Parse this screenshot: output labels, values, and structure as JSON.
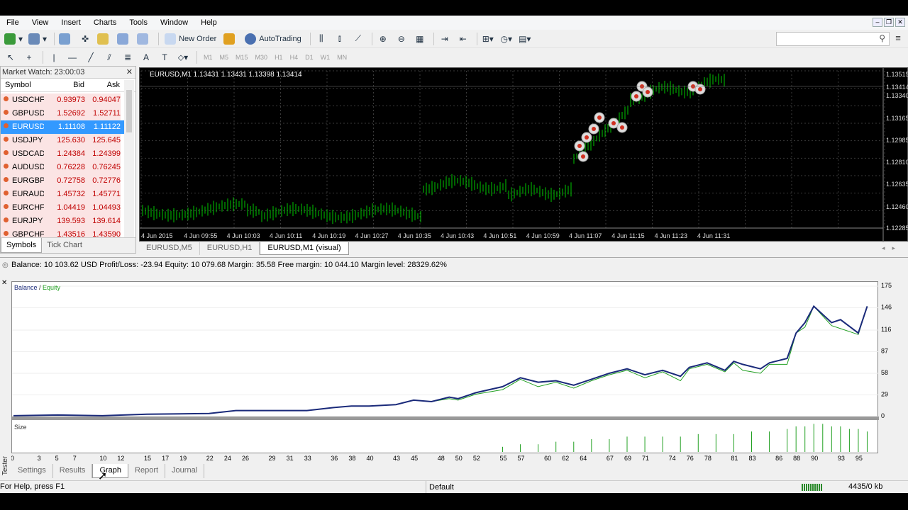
{
  "menu": [
    "File",
    "View",
    "Insert",
    "Charts",
    "Tools",
    "Window",
    "Help"
  ],
  "toolbar": {
    "new_order": "New Order",
    "auto_trading": "AutoTrading",
    "timeframes": [
      "M1",
      "M5",
      "M15",
      "M30",
      "H1",
      "H4",
      "D1",
      "W1",
      "MN"
    ]
  },
  "market_watch": {
    "title": "Market Watch: 23:00:03",
    "headers": {
      "symbol": "Symbol",
      "bid": "Bid",
      "ask": "Ask"
    },
    "rows": [
      {
        "symbol": "USDCHF",
        "bid": "0.93973",
        "ask": "0.94047"
      },
      {
        "symbol": "GBPUSD",
        "bid": "1.52692",
        "ask": "1.52711"
      },
      {
        "symbol": "EURUSD",
        "bid": "1.11108",
        "ask": "1.11122"
      },
      {
        "symbol": "USDJPY",
        "bid": "125.630",
        "ask": "125.645"
      },
      {
        "symbol": "USDCAD",
        "bid": "1.24384",
        "ask": "1.24399"
      },
      {
        "symbol": "AUDUSD",
        "bid": "0.76228",
        "ask": "0.76245"
      },
      {
        "symbol": "EURGBP",
        "bid": "0.72758",
        "ask": "0.72776"
      },
      {
        "symbol": "EURAUD",
        "bid": "1.45732",
        "ask": "1.45771"
      },
      {
        "symbol": "EURCHF",
        "bid": "1.04419",
        "ask": "1.04493"
      },
      {
        "symbol": "EURJPY",
        "bid": "139.593",
        "ask": "139.614"
      },
      {
        "symbol": "GBPCHF",
        "bid": "1.43516",
        "ask": "1.43590"
      }
    ],
    "selected": "EURUSD",
    "tabs": [
      "Symbols",
      "Tick Chart"
    ]
  },
  "chart": {
    "title": "EURUSD,M1  1.13431 1.13431 1.13398 1.13414",
    "price_labels": [
      "1.13515",
      "1.13414",
      "1.13340",
      "1.13165",
      "1.12985",
      "1.12810",
      "1.12635",
      "1.12460",
      "1.12285"
    ],
    "time_labels": [
      "4 Jun 2015",
      "4 Jun 09:55",
      "4 Jun 10:03",
      "4 Jun 10:11",
      "4 Jun 10:19",
      "4 Jun 10:27",
      "4 Jun 10:35",
      "4 Jun 10:43",
      "4 Jun 10:51",
      "4 Jun 10:59",
      "4 Jun 11:07",
      "4 Jun 11:15",
      "4 Jun 11:23",
      "4 Jun 11:31"
    ],
    "tabs": [
      "EURUSD,M5",
      "EURUSD,H1",
      "EURUSD,M1 (visual)"
    ],
    "active_tab": "EURUSD,M1 (visual)",
    "colors": {
      "background": "#000000",
      "candle": "#00c800",
      "grid": "#3a3a3a"
    }
  },
  "tester": {
    "account": "Balance: 10 103.62 USD  Profit/Loss: -23.94  Equity: 10 079.68  Margin: 35.58  Free margin: 10 044.10  Margin level: 28329.62%",
    "side_label": "Tester",
    "tabs": [
      "Settings",
      "Results",
      "Graph",
      "Report",
      "Journal"
    ],
    "active_tab": "Graph"
  },
  "chart_data": {
    "type": "line",
    "title": "",
    "legend": [
      "Balance",
      "Equity"
    ],
    "legend_separator": "/",
    "size_label": "Size",
    "x_ticks": [
      0,
      3,
      5,
      7,
      10,
      12,
      15,
      17,
      19,
      22,
      24,
      26,
      29,
      31,
      33,
      36,
      38,
      40,
      43,
      45,
      48,
      50,
      52,
      55,
      57,
      60,
      62,
      64,
      67,
      69,
      71,
      74,
      76,
      78,
      81,
      83,
      86,
      88,
      90,
      93,
      95
    ],
    "y_ticks": [
      0,
      29,
      58,
      87,
      116,
      146,
      175
    ],
    "ylim": [
      0,
      175
    ],
    "xlim": [
      0,
      97
    ],
    "series": [
      {
        "name": "Balance",
        "color": "#1a2a7a",
        "x": [
          0,
          5,
          10,
          15,
          22,
          25,
          33,
          36,
          38,
          40,
          43,
          45,
          47,
          49,
          50,
          52,
          55,
          57,
          59,
          61,
          63,
          65,
          67,
          69,
          71,
          73,
          75,
          76,
          78,
          80,
          81,
          82,
          84,
          85,
          87,
          88,
          89,
          90,
          92,
          93,
          95,
          96
        ],
        "y": [
          1,
          2,
          1,
          3,
          4,
          8,
          8,
          12,
          14,
          14,
          16,
          22,
          20,
          26,
          24,
          32,
          40,
          52,
          46,
          48,
          42,
          50,
          58,
          64,
          56,
          62,
          54,
          66,
          72,
          62,
          74,
          70,
          64,
          72,
          78,
          112,
          126,
          148,
          126,
          130,
          112,
          148
        ]
      },
      {
        "name": "Equity",
        "color": "#22a022",
        "x": [
          0,
          5,
          10,
          15,
          22,
          25,
          33,
          36,
          38,
          40,
          43,
          45,
          47,
          49,
          50,
          52,
          55,
          57,
          59,
          61,
          63,
          65,
          67,
          69,
          71,
          73,
          75,
          76,
          78,
          80,
          81,
          82,
          84,
          85,
          87,
          88,
          89,
          90,
          92,
          93,
          95,
          96
        ],
        "y": [
          1,
          2,
          1,
          3,
          4,
          8,
          8,
          12,
          14,
          14,
          16,
          22,
          20,
          24,
          22,
          30,
          36,
          50,
          40,
          46,
          38,
          48,
          56,
          62,
          52,
          60,
          48,
          64,
          70,
          60,
          72,
          62,
          58,
          70,
          70,
          112,
          120,
          148,
          122,
          118,
          110,
          148
        ]
      }
    ],
    "size_series": {
      "color": "#22a022",
      "x": [
        55,
        57,
        59,
        61,
        63,
        65,
        67,
        69,
        71,
        73,
        75,
        77,
        79,
        81,
        83,
        85,
        87,
        88,
        89,
        90,
        91,
        92,
        93,
        94,
        95,
        96
      ],
      "y": [
        2,
        3,
        3,
        4,
        4,
        5,
        5,
        6,
        6,
        6,
        6,
        7,
        7,
        7,
        8,
        8,
        9,
        10,
        10,
        11,
        11,
        10,
        10,
        9,
        9,
        8
      ]
    }
  },
  "status": {
    "help": "For Help, press F1",
    "profile": "Default",
    "memory": "4435/0 kb"
  }
}
